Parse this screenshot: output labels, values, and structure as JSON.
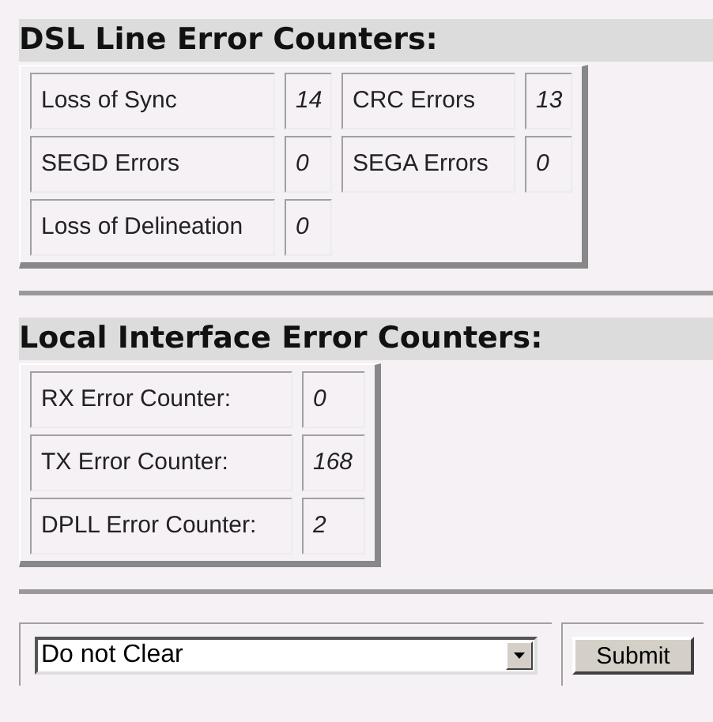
{
  "sections": [
    {
      "title": "DSL Line Error Counters:",
      "rows": [
        [
          {
            "label": "Loss of Sync",
            "value": "14"
          },
          {
            "label": "CRC Errors",
            "value": "13"
          }
        ],
        [
          {
            "label": "SEGD Errors",
            "value": "0"
          },
          {
            "label": "SEGA Errors",
            "value": "0"
          }
        ],
        [
          {
            "label": "Loss of Delineation",
            "value": "0"
          }
        ]
      ]
    },
    {
      "title": "Local Interface Error Counters:",
      "rows": [
        [
          {
            "label": "RX Error Counter:",
            "value": "0"
          }
        ],
        [
          {
            "label": "TX Error Counter:",
            "value": "168"
          }
        ],
        [
          {
            "label": "DPLL Error Counter:",
            "value": "2"
          }
        ]
      ]
    }
  ],
  "form": {
    "clear_select": {
      "value": "Do not Clear"
    },
    "submit_button": "Submit"
  }
}
